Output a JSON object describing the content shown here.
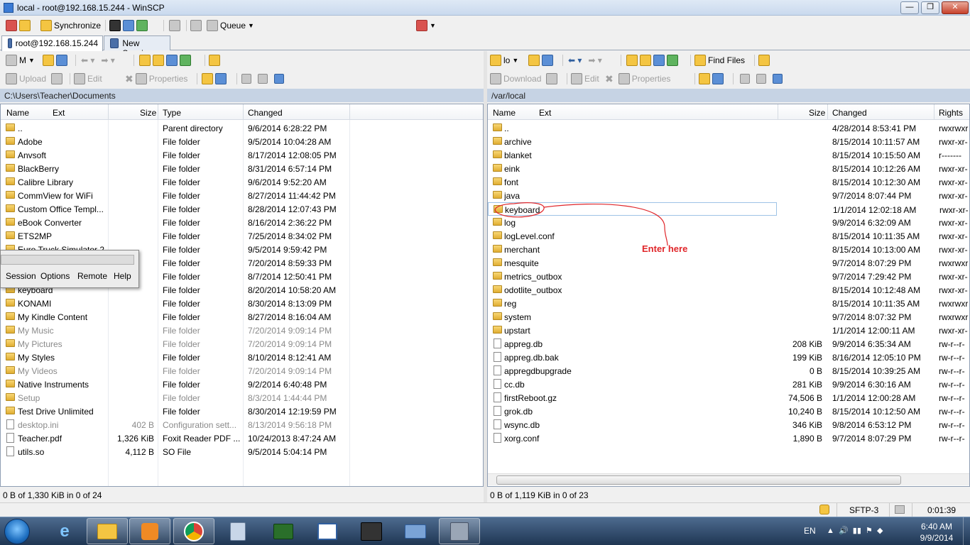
{
  "window": {
    "title": "local - root@192.168.15.244 - WinSCP"
  },
  "toolbar": {
    "synchronize": "Synchronize",
    "queue": "Queue"
  },
  "tabs": [
    {
      "label": "root@192.168.15.244"
    },
    {
      "label": "New Session"
    }
  ],
  "left": {
    "toolbar1": {
      "drive": "M"
    },
    "toolbar2": {
      "upload": "Upload",
      "edit": "Edit",
      "properties": "Properties"
    },
    "path": "C:\\Users\\Teacher\\Documents",
    "columns": {
      "name": "Name",
      "ext": "Ext",
      "size": "Size",
      "type": "Type",
      "changed": "Changed"
    },
    "rows": [
      {
        "name": "..",
        "size": "",
        "type": "Parent directory",
        "changed": "9/6/2014  6:28:22 PM",
        "icon": "parent"
      },
      {
        "name": "Adobe",
        "size": "",
        "type": "File folder",
        "changed": "9/5/2014  10:04:28 AM",
        "icon": "folder"
      },
      {
        "name": "Anvsoft",
        "size": "",
        "type": "File folder",
        "changed": "8/17/2014  12:08:05 PM",
        "icon": "folder"
      },
      {
        "name": "BlackBerry",
        "size": "",
        "type": "File folder",
        "changed": "8/31/2014  6:57:14 PM",
        "icon": "folder"
      },
      {
        "name": "Calibre Library",
        "size": "",
        "type": "File folder",
        "changed": "9/6/2014  9:52:20 AM",
        "icon": "folder"
      },
      {
        "name": "CommView for WiFi",
        "size": "",
        "type": "File folder",
        "changed": "8/27/2014  11:44:42 PM",
        "icon": "folder"
      },
      {
        "name": "Custom Office Templ...",
        "size": "",
        "type": "File folder",
        "changed": "8/28/2014  12:07:43 PM",
        "icon": "folder"
      },
      {
        "name": "eBook Converter",
        "size": "",
        "type": "File folder",
        "changed": "8/16/2014  2:36:22 PM",
        "icon": "folder"
      },
      {
        "name": "ETS2MP",
        "size": "",
        "type": "File folder",
        "changed": "7/25/2014  8:34:02 PM",
        "icon": "folder"
      },
      {
        "name": "Euro Truck Simulator 2",
        "size": "",
        "type": "File folder",
        "changed": "9/5/2014  9:59:42 PM",
        "icon": "folder"
      },
      {
        "name": "",
        "size": "",
        "type": "File folder",
        "changed": "7/20/2014  8:59:33 PM",
        "icon": "folder"
      },
      {
        "name": "",
        "size": "",
        "type": "File folder",
        "changed": "8/7/2014  12:50:41 PM",
        "icon": "folder"
      },
      {
        "name": "keyboard",
        "size": "",
        "type": "File folder",
        "changed": "8/20/2014  10:58:20 AM",
        "icon": "folder"
      },
      {
        "name": "KONAMI",
        "size": "",
        "type": "File folder",
        "changed": "8/30/2014  8:13:09 PM",
        "icon": "folder"
      },
      {
        "name": "My Kindle Content",
        "size": "",
        "type": "File folder",
        "changed": "8/27/2014  8:16:04 AM",
        "icon": "folder"
      },
      {
        "name": "My Music",
        "size": "",
        "type": "File folder",
        "changed": "7/20/2014  9:09:14 PM",
        "icon": "folder",
        "grey": true
      },
      {
        "name": "My Pictures",
        "size": "",
        "type": "File folder",
        "changed": "7/20/2014  9:09:14 PM",
        "icon": "folder",
        "grey": true
      },
      {
        "name": "My Styles",
        "size": "",
        "type": "File folder",
        "changed": "8/10/2014  8:12:41 AM",
        "icon": "folder"
      },
      {
        "name": "My Videos",
        "size": "",
        "type": "File folder",
        "changed": "7/20/2014  9:09:14 PM",
        "icon": "folder",
        "grey": true
      },
      {
        "name": "Native Instruments",
        "size": "",
        "type": "File folder",
        "changed": "9/2/2014  6:40:48 PM",
        "icon": "folder"
      },
      {
        "name": "Setup",
        "size": "",
        "type": "File folder",
        "changed": "8/3/2014  1:44:44 PM",
        "icon": "folder",
        "grey": true
      },
      {
        "name": "Test Drive Unlimited",
        "size": "",
        "type": "File folder",
        "changed": "8/30/2014  12:19:59 PM",
        "icon": "folder"
      },
      {
        "name": "desktop.ini",
        "size": "402 B",
        "type": "Configuration sett...",
        "changed": "8/13/2014  9:56:18 PM",
        "icon": "file",
        "grey": true
      },
      {
        "name": "Teacher.pdf",
        "size": "1,326 KiB",
        "type": "Foxit Reader PDF ...",
        "changed": "10/24/2013  8:47:24 AM",
        "icon": "file"
      },
      {
        "name": "utils.so",
        "size": "4,112 B",
        "type": "SO File",
        "changed": "9/5/2014  5:04:14 PM",
        "icon": "file"
      }
    ],
    "status": "0 B of 1,330 KiB in 0 of 24"
  },
  "right": {
    "toolbar1": {
      "drive": "lo",
      "find": "Find Files"
    },
    "toolbar2": {
      "download": "Download",
      "edit": "Edit",
      "properties": "Properties"
    },
    "path": "/var/local",
    "columns": {
      "name": "Name",
      "ext": "Ext",
      "size": "Size",
      "changed": "Changed",
      "rights": "Rights"
    },
    "rows": [
      {
        "name": "..",
        "size": "",
        "changed": "4/28/2014  8:53:41 PM",
        "rights": "rwxrwxr",
        "icon": "parent"
      },
      {
        "name": "archive",
        "size": "",
        "changed": "8/15/2014  10:11:57 AM",
        "rights": "rwxr-xr-",
        "icon": "folder"
      },
      {
        "name": "blanket",
        "size": "",
        "changed": "8/15/2014  10:15:50 AM",
        "rights": "r-------",
        "icon": "folder"
      },
      {
        "name": "eink",
        "size": "",
        "changed": "8/15/2014  10:12:26 AM",
        "rights": "rwxr-xr-",
        "icon": "folder"
      },
      {
        "name": "font",
        "size": "",
        "changed": "8/15/2014  10:12:30 AM",
        "rights": "rwxr-xr-",
        "icon": "folder"
      },
      {
        "name": "java",
        "size": "",
        "changed": "9/7/2014  8:07:44 PM",
        "rights": "rwxr-xr-",
        "icon": "folder"
      },
      {
        "name": "keyboard",
        "size": "",
        "changed": "1/1/2014  12:02:18 AM",
        "rights": "rwxr-xr-",
        "icon": "folder"
      },
      {
        "name": "log",
        "size": "",
        "changed": "9/9/2014  6:32:09 AM",
        "rights": "rwxr-xr-",
        "icon": "folder"
      },
      {
        "name": "logLevel.conf",
        "size": "",
        "changed": "8/15/2014  10:11:35 AM",
        "rights": "rwxr-xr-",
        "icon": "folder"
      },
      {
        "name": "merchant",
        "size": "",
        "changed": "8/15/2014  10:13:00 AM",
        "rights": "rwxr-xr-",
        "icon": "folder"
      },
      {
        "name": "mesquite",
        "size": "",
        "changed": "9/7/2014  8:07:29 PM",
        "rights": "rwxrwxr",
        "icon": "folder"
      },
      {
        "name": "metrics_outbox",
        "size": "",
        "changed": "9/7/2014  7:29:42 PM",
        "rights": "rwxr-xr-",
        "icon": "folder"
      },
      {
        "name": "odotlite_outbox",
        "size": "",
        "changed": "8/15/2014  10:12:48 AM",
        "rights": "rwxr-xr-",
        "icon": "folder"
      },
      {
        "name": "reg",
        "size": "",
        "changed": "8/15/2014  10:11:35 AM",
        "rights": "rwxrwxr",
        "icon": "folder"
      },
      {
        "name": "system",
        "size": "",
        "changed": "9/7/2014  8:07:32 PM",
        "rights": "rwxrwxr",
        "icon": "folder"
      },
      {
        "name": "upstart",
        "size": "",
        "changed": "1/1/2014  12:00:11 AM",
        "rights": "rwxr-xr-",
        "icon": "folder"
      },
      {
        "name": "appreg.db",
        "size": "208 KiB",
        "changed": "9/9/2014  6:35:34 AM",
        "rights": "rw-r--r-",
        "icon": "file"
      },
      {
        "name": "appreg.db.bak",
        "size": "199 KiB",
        "changed": "8/16/2014  12:05:10 PM",
        "rights": "rw-r--r-",
        "icon": "file"
      },
      {
        "name": "appregdbupgrade",
        "size": "0 B",
        "changed": "8/15/2014  10:39:25 AM",
        "rights": "rw-r--r-",
        "icon": "file"
      },
      {
        "name": "cc.db",
        "size": "281 KiB",
        "changed": "9/9/2014  6:30:16 AM",
        "rights": "rw-r--r-",
        "icon": "file"
      },
      {
        "name": "firstReboot.gz",
        "size": "74,506 B",
        "changed": "1/1/2014  12:00:28 AM",
        "rights": "rw-r--r-",
        "icon": "file"
      },
      {
        "name": "grok.db",
        "size": "10,240 B",
        "changed": "8/15/2014  10:12:50 AM",
        "rights": "rw-r--r-",
        "icon": "file"
      },
      {
        "name": "wsync.db",
        "size": "346 KiB",
        "changed": "9/8/2014  6:53:12 PM",
        "rights": "rw-r--r-",
        "icon": "file"
      },
      {
        "name": "xorg.conf",
        "size": "1,890 B",
        "changed": "9/7/2014  8:07:29 PM",
        "rights": "rw-r--r-",
        "icon": "file"
      }
    ],
    "status": "0 B of 1,119 KiB in 0 of 23"
  },
  "annotation": {
    "text": "Enter here"
  },
  "popup_menu": {
    "items": [
      "Session",
      "Options",
      "Remote",
      "Help"
    ]
  },
  "bottom": {
    "protocol": "SFTP-3",
    "time": "0:01:39"
  },
  "taskbar": {
    "lang": "EN",
    "clock_time": "6:40 AM",
    "clock_date": "9/9/2014"
  }
}
